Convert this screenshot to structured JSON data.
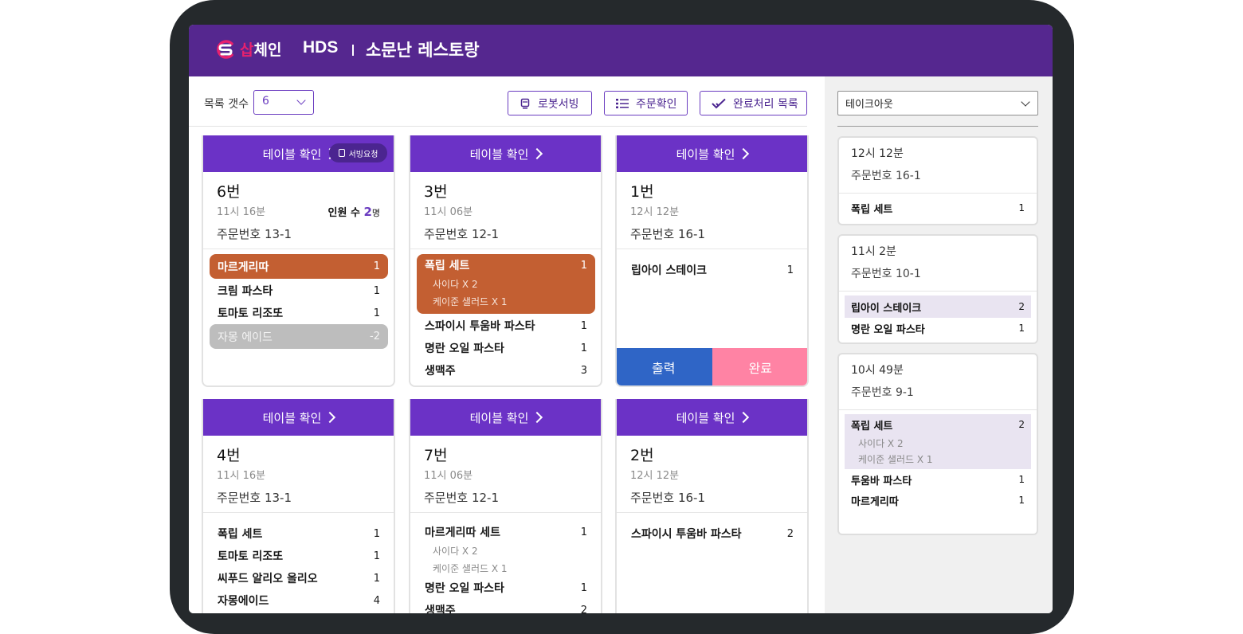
{
  "header": {
    "brand_colored": "삽",
    "brand_white": "체인",
    "system": "HDS",
    "store_name": "소문난 레스토랑"
  },
  "toolbar": {
    "count_label": "목록 갯수",
    "count_value": "6",
    "robot_serving": "로봇서빙",
    "order_check": "주문확인",
    "completed_list": "완료처리 목록"
  },
  "cards": [
    {
      "head": "테이블 확인",
      "table": "6번",
      "time": "11시 16분",
      "order": "주문번호 13-1",
      "badge": "서빙요청",
      "people_label": "인원 수",
      "people_count": "2",
      "people_unit": "명",
      "items": [
        {
          "name": "마르게리따",
          "qty": "1"
        },
        {
          "name": "크림 파스타",
          "qty": "1"
        },
        {
          "name": "토마토 리조또",
          "qty": "1"
        },
        {
          "name": "자몽 에이드",
          "qty": "-2"
        }
      ]
    },
    {
      "head": "테이블 확인",
      "table": "3번",
      "time": "11시 06분",
      "order": "주문번호 12-1",
      "items": [
        {
          "name": "폭립 세트",
          "qty": "1",
          "subs": [
            "사이다 X 2",
            "케이준 샐러드 X 1"
          ]
        },
        {
          "name": "스파이시 투움바 파스타",
          "qty": "1"
        },
        {
          "name": "명란 오일 파스타",
          "qty": "1"
        },
        {
          "name": "생맥주",
          "qty": "3"
        }
      ]
    },
    {
      "head": "테이블 확인",
      "table": "1번",
      "time": "12시 12분",
      "order": "주문번호 16-1",
      "items": [
        {
          "name": "립아이 스테이크",
          "qty": "1"
        }
      ],
      "print": "출력",
      "done": "완료"
    },
    {
      "head": "테이블 확인",
      "table": "4번",
      "time": "11시 16분",
      "order": "주문번호 13-1",
      "items": [
        {
          "name": "폭립 세트",
          "qty": "1"
        },
        {
          "name": "토마토 리조또",
          "qty": "1"
        },
        {
          "name": "씨푸드 알리오 올리오",
          "qty": "1"
        },
        {
          "name": "자몽에이드",
          "qty": "4"
        }
      ]
    },
    {
      "head": "테이블 확인",
      "table": "7번",
      "time": "11시 06분",
      "order": "주문번호 12-1",
      "items": [
        {
          "name": "마르게리따 세트",
          "qty": "1",
          "subs": [
            "사이다 X 2",
            "케이준 샐러드 X 1"
          ]
        },
        {
          "name": "명란 오일 파스타",
          "qty": "1"
        },
        {
          "name": "생맥주",
          "qty": "2"
        }
      ]
    },
    {
      "head": "테이블 확인",
      "table": "2번",
      "time": "12시 12분",
      "order": "주문번호 16-1",
      "items": [
        {
          "name": "스파이시 투움바 파스타",
          "qty": "2"
        }
      ]
    }
  ],
  "sidebar": {
    "filter": "테이크아웃",
    "orders": [
      {
        "time": "12시 12분",
        "order": "주문번호 16-1",
        "items": [
          {
            "name": "폭립 세트",
            "qty": "1"
          }
        ]
      },
      {
        "time": "11시 2분",
        "order": "주문번호 10-1",
        "items": [
          {
            "name": "립아이 스테이크",
            "qty": "2"
          },
          {
            "name": "명란 오일 파스타",
            "qty": "1"
          }
        ]
      },
      {
        "time": "10시 49분",
        "order": "주문번호 9-1",
        "items": [
          {
            "name": "폭립 세트",
            "qty": "2",
            "subs": [
              "사이다 X 2",
              "케이준 샐러드 X 1"
            ]
          },
          {
            "name": "투움바 파스타",
            "qty": "1"
          },
          {
            "name": "마르게리따",
            "qty": "1"
          }
        ]
      }
    ]
  },
  "colors": {
    "header": "#55278f",
    "card_head": "#6b32c6",
    "highlight_item": "#c35f32",
    "print_button": "#2f65c6",
    "done_button": "#ff83a4"
  }
}
